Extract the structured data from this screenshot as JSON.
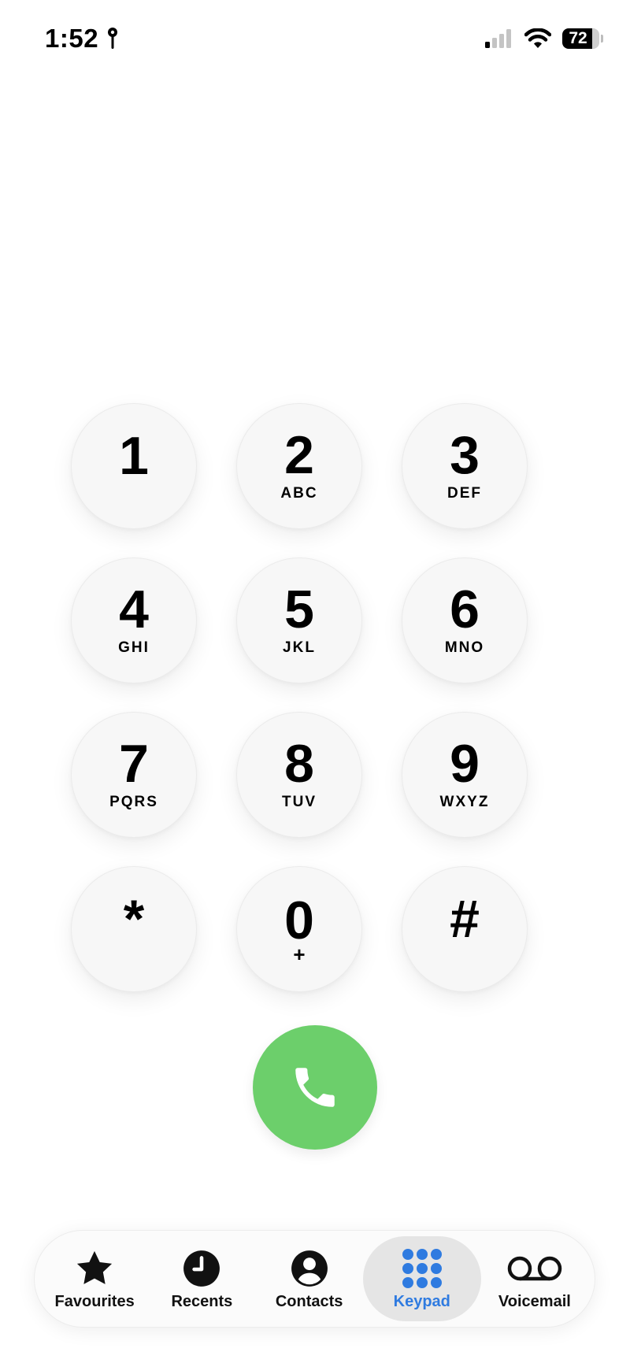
{
  "status_bar": {
    "time": "1:52",
    "battery": "72",
    "icons": [
      "location-icon",
      "signal-icon",
      "wifi-icon",
      "battery-icon"
    ]
  },
  "keypad": {
    "keys": [
      {
        "digit": "1",
        "letters": ""
      },
      {
        "digit": "2",
        "letters": "ABC"
      },
      {
        "digit": "3",
        "letters": "DEF"
      },
      {
        "digit": "4",
        "letters": "GHI"
      },
      {
        "digit": "5",
        "letters": "JKL"
      },
      {
        "digit": "6",
        "letters": "MNO"
      },
      {
        "digit": "7",
        "letters": "PQRS"
      },
      {
        "digit": "8",
        "letters": "TUV"
      },
      {
        "digit": "9",
        "letters": "WXYZ"
      },
      {
        "digit": "*",
        "letters": ""
      },
      {
        "digit": "0",
        "letters": "+"
      },
      {
        "digit": "#",
        "letters": ""
      }
    ]
  },
  "call_button": {
    "icon": "phone-icon",
    "color": "#6ccf6b"
  },
  "tab_bar": {
    "active_color": "#2f7be0",
    "tabs": [
      {
        "label": "Favourites",
        "icon": "star-icon",
        "active": false
      },
      {
        "label": "Recents",
        "icon": "clock-icon",
        "active": false
      },
      {
        "label": "Contacts",
        "icon": "person-circle-icon",
        "active": false
      },
      {
        "label": "Keypad",
        "icon": "keypad-grid-icon",
        "active": true
      },
      {
        "label": "Voicemail",
        "icon": "voicemail-icon",
        "active": false
      }
    ]
  }
}
